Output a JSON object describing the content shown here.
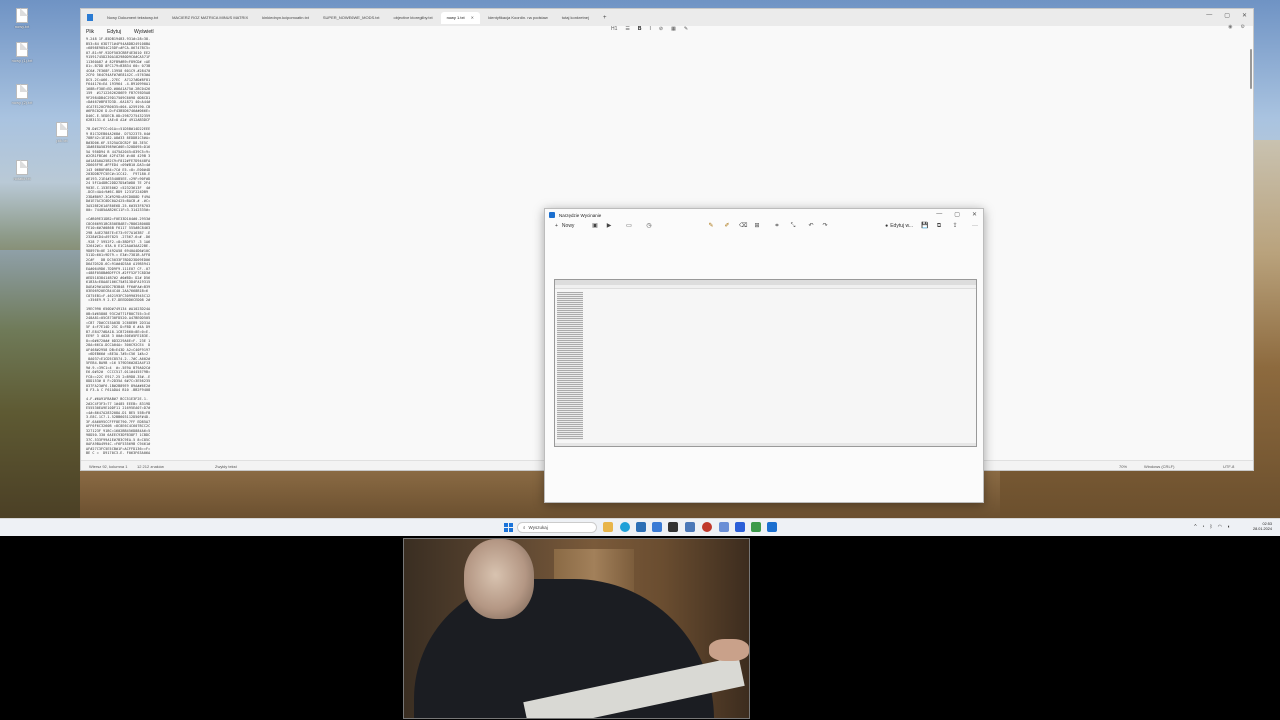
{
  "desktop": {
    "icons": [
      "nowy.txt",
      "nowy (1).txt",
      "nowy (2).txt",
      "plik.txt",
      "notatki.txt"
    ]
  },
  "notepad": {
    "tabs": [
      {
        "label": "Nowy Dokument tekstowy.txt",
        "active": false
      },
      {
        "label": "MACIERZ ROZ MATRICA MINUS MATRIX",
        "active": false
      },
      {
        "label": "kinkiednyn.kcipomoatin.txt",
        "active": false
      },
      {
        "label": "SUPER_NOWE6WE_MODS.txt",
        "active": false
      },
      {
        "label": "objective ktoregilby.txt",
        "active": false
      },
      {
        "label": "nowy 1.txt",
        "active": true
      },
      {
        "label": "Identyfikacja Koordin. na podstaw",
        "active": false
      },
      {
        "label": "tutaj konkretnej",
        "active": false
      }
    ],
    "plus": "+",
    "menu": {
      "file": "Plik",
      "edit": "Edytuj",
      "view": "Wyświetl"
    },
    "toolbar": {
      "heading": "H1",
      "list": "☰",
      "bold": "B",
      "italic": "I",
      "link": "⊘",
      "table": "▦",
      "clear": "✎"
    },
    "status": {
      "position": "Wiersz 92, kolumna 1",
      "chars": "12 212 znaków",
      "format": "Zwykły tekst",
      "zoom": "70%",
      "line_ending": "Windows (CRLF)",
      "encoding": "UTF-8"
    },
    "win_controls": {
      "min": "—",
      "max": "▢",
      "close": "✕"
    }
  },
  "snip": {
    "title": "Narzędzie Wycinanie",
    "new_label": "Nowy",
    "share_label": "Edytuj w...",
    "more": "···",
    "win_controls": {
      "min": "—",
      "max": "▢",
      "close": "✕"
    }
  },
  "taskbar": {
    "search_placeholder": "Wyszukaj",
    "time": "02:53",
    "date": "28.01.2024"
  },
  "colors": {
    "accent": "#1a73d9",
    "taskbar": "#eef1f5"
  }
}
